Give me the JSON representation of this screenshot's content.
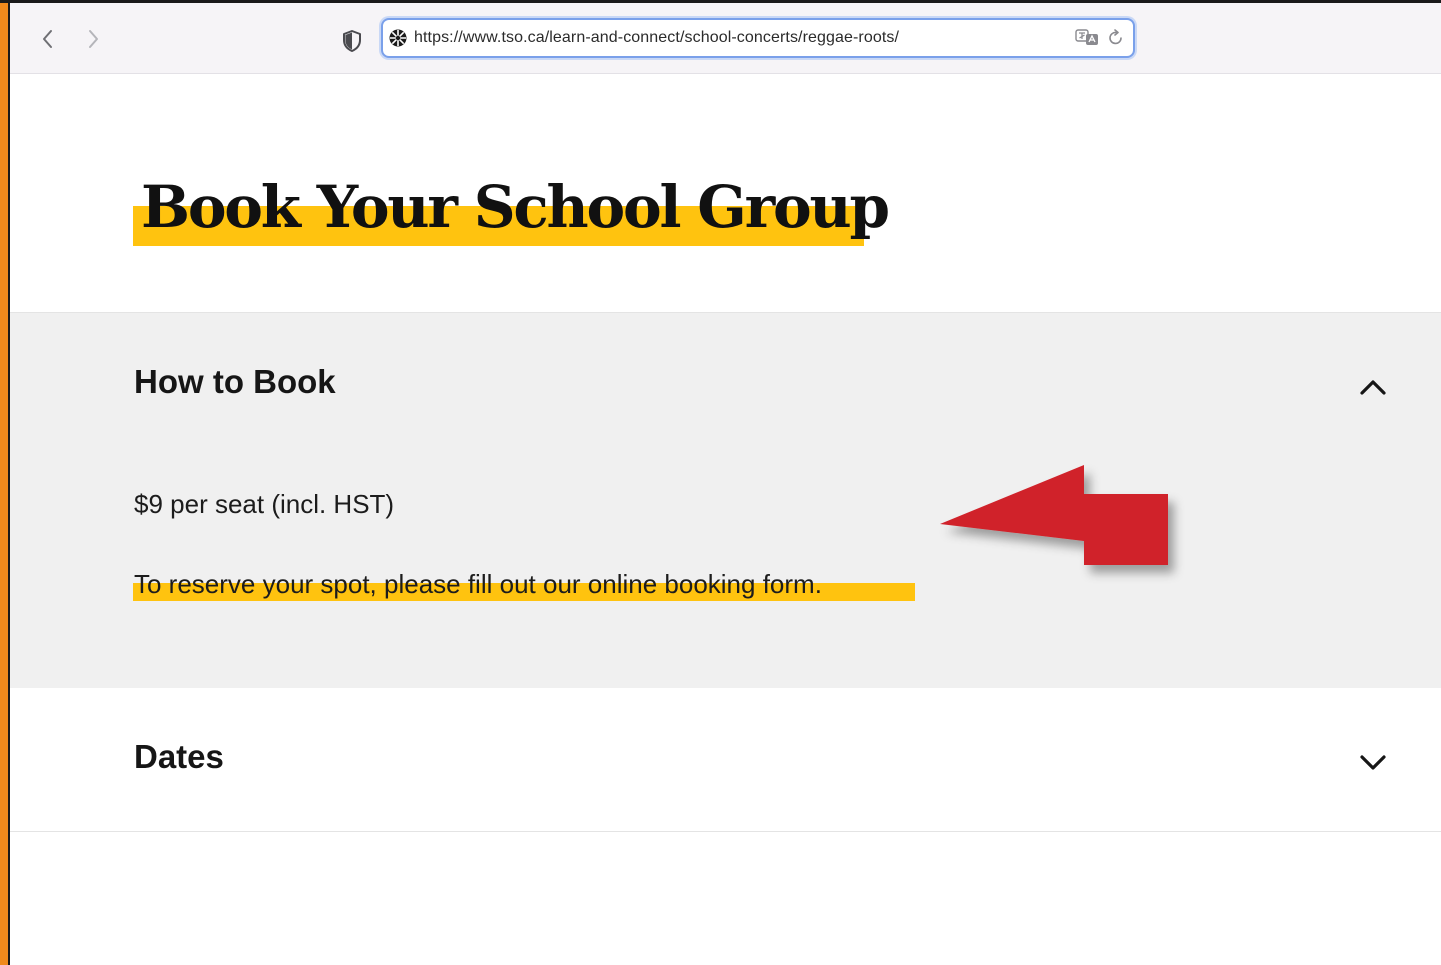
{
  "browser": {
    "url": "https://www.tso.ca/learn-and-connect/school-concerts/reggae-roots/",
    "icons": {
      "back": "chevron-left-icon",
      "forward": "chevron-right-icon",
      "tracking": "shield-icon",
      "favicon": "site-favicon-icon",
      "translate": "translate-icon",
      "reload": "reload-icon"
    }
  },
  "page": {
    "title": "Book Your School Group",
    "highlight_color": "#ffc30f"
  },
  "sections": {
    "how_to_book": {
      "heading": "How to Book",
      "expanded": true,
      "price_text": "$9 per seat (incl. HST)",
      "reserve_text": "To reserve your spot, please fill out our online booking form."
    },
    "dates": {
      "heading": "Dates",
      "expanded": false
    }
  },
  "annotation": {
    "arrow_color": "#d0232a",
    "icon": "red-arrow-icon"
  }
}
